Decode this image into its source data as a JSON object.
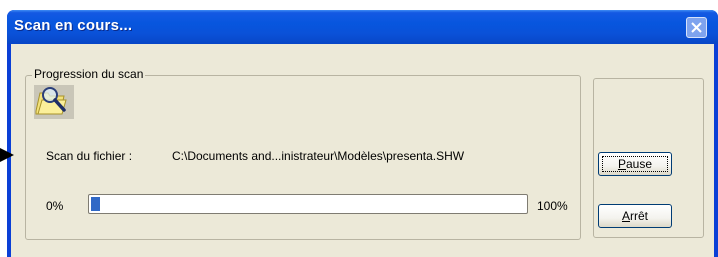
{
  "window": {
    "title": "Scan en cours..."
  },
  "group": {
    "legend": "Progression du scan",
    "file_label": "Scan du fichier :",
    "file_path": "C:\\Documents and...inistrateur\\Modèles\\presenta.SHW",
    "progress": {
      "start_label": "0%",
      "end_label": "100%",
      "value_fraction": 0.02
    }
  },
  "buttons": {
    "pause": {
      "label_pre": "",
      "accel": "P",
      "label_post": "ause"
    },
    "stop": {
      "label_pre": "",
      "accel": "A",
      "label_post": "rrêt"
    }
  },
  "colors": {
    "titlebar": "#0a51d8",
    "progress_fill": "#3169c6",
    "client_bg": "#ece9d8"
  }
}
